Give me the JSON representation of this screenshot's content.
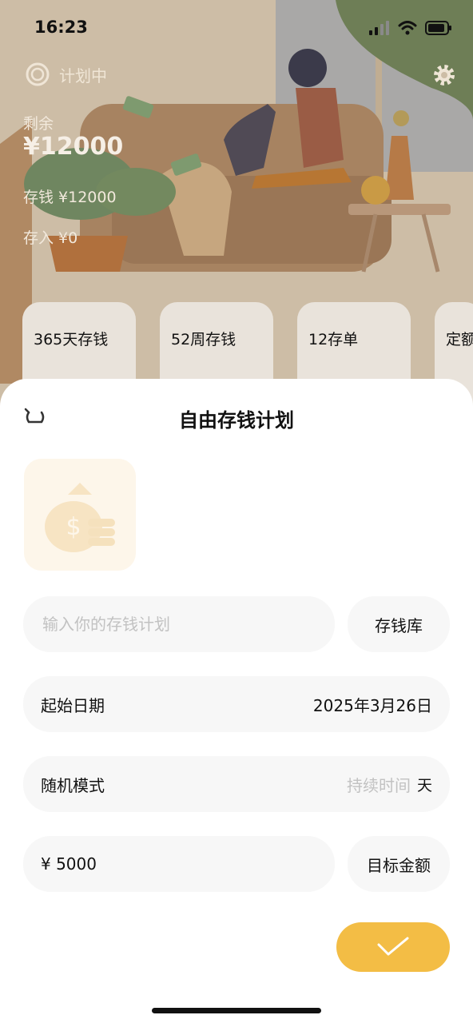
{
  "status_bar": {
    "time": "16:23"
  },
  "header": {
    "plan_status": "计划中",
    "remaining_label": "剩余",
    "remaining_value": "¥12000",
    "saved_line": "存钱 ¥12000",
    "deposit_line": "存入 ¥0"
  },
  "plan_types": [
    {
      "label": "365天存钱"
    },
    {
      "label": "52周存钱"
    },
    {
      "label": "12存单"
    },
    {
      "label": "定额"
    }
  ],
  "sheet": {
    "title": "自由存钱计划",
    "plan_input": {
      "placeholder": "输入你的存钱计划",
      "value": ""
    },
    "library_button": "存钱库",
    "start_date_label": "起始日期",
    "start_date_value": "2025年3月26日",
    "mode_label": "随机模式",
    "duration_placeholder": "持续时间",
    "duration_unit": "天",
    "amount_value": "¥ 5000",
    "target_amount_button": "目标金额"
  },
  "colors": {
    "accent": "#f3bd45",
    "field_bg": "#f7f7f7",
    "placeholder": "#c2c2c2",
    "overlay_bg": "#cfbfa8"
  },
  "icons": {
    "plan_status": "coin-icon",
    "settings": "gear-icon",
    "back": "undo-icon",
    "plan_image": "money-bag-icon",
    "confirm": "check-icon"
  }
}
